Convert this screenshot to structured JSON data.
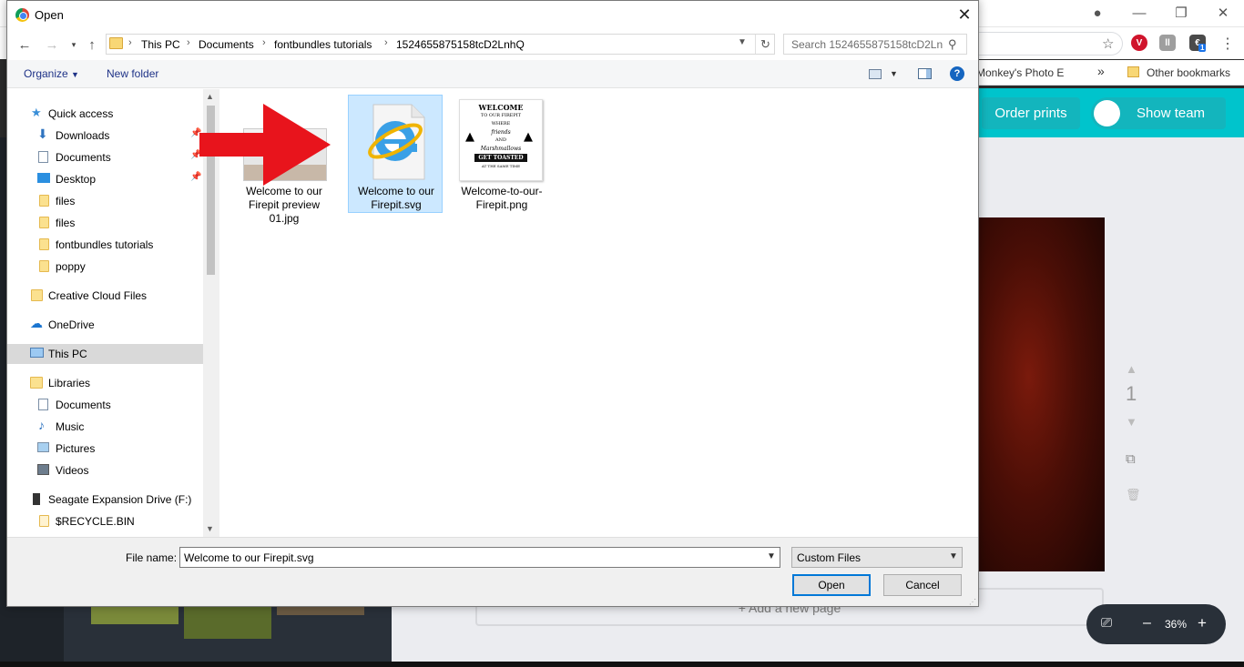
{
  "dialog": {
    "title": "Open",
    "close_glyph": "✕",
    "breadcrumb": [
      "This PC",
      "Documents",
      "fontbundles tutorials",
      "1524655875158tcD2LnhQ"
    ],
    "search_placeholder": "Search 1524655875158tcD2Ln",
    "toolbar": {
      "organize": "Organize",
      "new_folder": "New folder"
    },
    "nav_items": [
      {
        "label": "Quick access",
        "icon": "star-icon",
        "pinned": false
      },
      {
        "label": "Downloads",
        "icon": "download-icon",
        "pinned": true
      },
      {
        "label": "Documents",
        "icon": "document-icon",
        "pinned": true
      },
      {
        "label": "Desktop",
        "icon": "desktop-icon",
        "pinned": true
      },
      {
        "label": "files",
        "icon": "folder-icon",
        "pinned": false
      },
      {
        "label": "files",
        "icon": "folder-icon",
        "pinned": false
      },
      {
        "label": "fontbundles tutorials",
        "icon": "folder-icon",
        "pinned": false
      },
      {
        "label": "poppy",
        "icon": "folder-icon",
        "pinned": false
      },
      {
        "label": "Creative Cloud Files",
        "icon": "creative-cloud-icon",
        "pinned": false
      },
      {
        "label": "OneDrive",
        "icon": "cloud-icon",
        "pinned": false
      },
      {
        "label": "This PC",
        "icon": "computer-icon",
        "pinned": false,
        "selected": true
      },
      {
        "label": "Libraries",
        "icon": "library-icon",
        "pinned": false
      },
      {
        "label": "Documents",
        "icon": "document-icon",
        "pinned": false
      },
      {
        "label": "Music",
        "icon": "music-icon",
        "pinned": false
      },
      {
        "label": "Pictures",
        "icon": "pictures-icon",
        "pinned": false
      },
      {
        "label": "Videos",
        "icon": "videos-icon",
        "pinned": false
      },
      {
        "label": "Seagate Expansion Drive (F:)",
        "icon": "drive-icon",
        "pinned": false
      },
      {
        "label": "$RECYCLE.BIN",
        "icon": "folder-icon",
        "pinned": false
      }
    ],
    "files": [
      {
        "name": "Welcome to our Firepit preview 01.jpg",
        "selected": false
      },
      {
        "name": "Welcome to our Firepit.svg",
        "selected": true
      },
      {
        "name": "Welcome-to-our-Firepit.png",
        "selected": false
      }
    ],
    "thumb_text": [
      "WELCOME",
      "TO OUR FIREPIT",
      "WHERE",
      "friends",
      "AND",
      "Marshmallows",
      "GET TOASTED",
      "AT THE SAME TIME"
    ],
    "file_name_label": "File name:",
    "file_name_value": "Welcome to our Firepit.svg",
    "file_type": "Custom Files",
    "open_label": "Open",
    "cancel_label": "Cancel"
  },
  "browser": {
    "bookmark_1": "Monkey's Photo E",
    "bookmark_overflow": "»",
    "other_bookmarks": "Other bookmarks",
    "ext_badge": "1"
  },
  "canva": {
    "order_prints": "Order prints",
    "show_team": "Show team",
    "page_number": "1",
    "add_page": "+ Add a new page",
    "zoom": "36%",
    "zoom_minus": "–",
    "zoom_plus": "+"
  },
  "colors": {
    "canva_teal": "#00c4cc",
    "selection_blue": "#cce8ff",
    "arrow_red": "#e8141c",
    "primary_border": "#0078d7"
  }
}
